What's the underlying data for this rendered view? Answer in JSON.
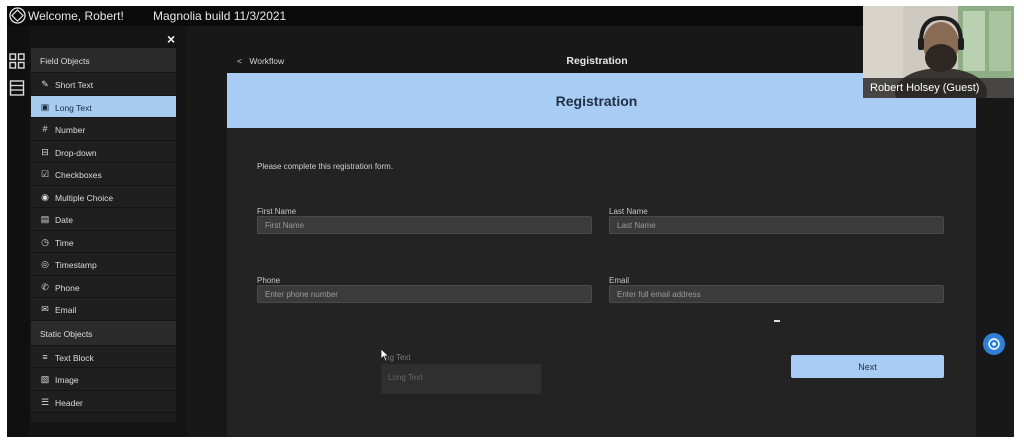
{
  "topbar": {
    "welcome": "Welcome, Robert!",
    "build": "Magnolia build 11/3/2021"
  },
  "palette": {
    "field_header": "Field Objects",
    "field_items": [
      {
        "label": "Short Text",
        "icon": "pencil-icon"
      },
      {
        "label": "Long Text",
        "icon": "edit-box-icon",
        "active": true
      },
      {
        "label": "Number",
        "icon": "hash-icon"
      },
      {
        "label": "Drop-down",
        "icon": "dropdown-icon"
      },
      {
        "label": "Checkboxes",
        "icon": "checkbox-icon"
      },
      {
        "label": "Multiple Choice",
        "icon": "radio-icon"
      },
      {
        "label": "Date",
        "icon": "calendar-icon"
      },
      {
        "label": "Time",
        "icon": "clock-icon"
      },
      {
        "label": "Timestamp",
        "icon": "timestamp-icon"
      },
      {
        "label": "Phone",
        "icon": "phone-icon"
      },
      {
        "label": "Email",
        "icon": "mail-icon"
      }
    ],
    "static_header": "Static Objects",
    "static_items": [
      {
        "label": "Text Block",
        "icon": "text-block-icon"
      },
      {
        "label": "Image",
        "icon": "image-icon"
      },
      {
        "label": "Header",
        "icon": "header-icon"
      }
    ],
    "close": "×"
  },
  "nav": {
    "back_label": "Workflow",
    "page_title": "Registration"
  },
  "form": {
    "title": "Registration",
    "intro": "Please complete this registration form.",
    "first_name": {
      "label": "First Name",
      "placeholder": "First Name"
    },
    "last_name": {
      "label": "Last Name",
      "placeholder": "Last Name"
    },
    "phone": {
      "label": "Phone",
      "placeholder": "Enter phone number"
    },
    "email": {
      "label": "Email",
      "placeholder": "Enter full email address"
    },
    "next_label": "Next"
  },
  "drag_ghost": {
    "label": "ng Text",
    "placeholder": "Long Text"
  },
  "video": {
    "participant": "Robert Holsey (Guest)"
  },
  "colors": {
    "accent": "#a9ccf5",
    "active_item": "#a8cbf0",
    "fab": "#2f80d6"
  }
}
